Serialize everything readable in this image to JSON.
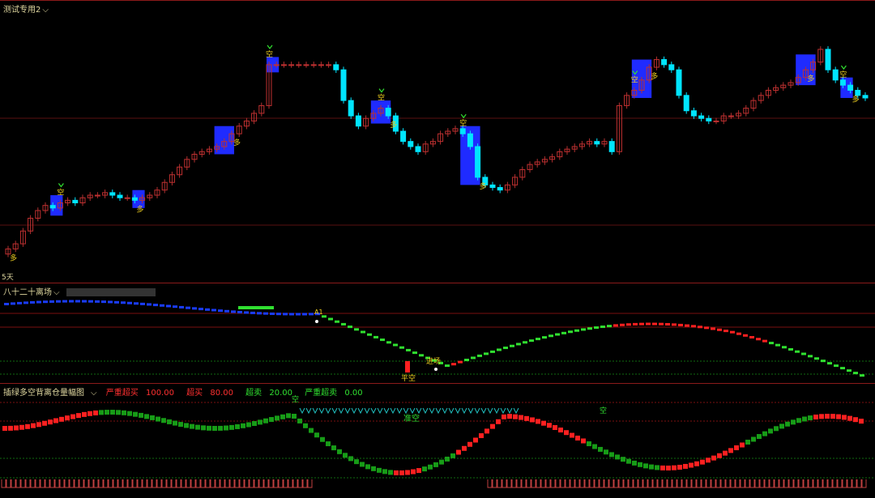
{
  "main_panel": {
    "title": "测试专用2",
    "period_label": "5天",
    "markers": {
      "buy": "多",
      "sell": "空"
    },
    "chart_data": {
      "type": "candlestick",
      "closes": [
        10,
        12,
        17,
        22,
        25,
        27,
        26,
        28,
        29,
        28,
        30,
        31,
        31,
        32,
        31,
        30,
        30,
        29,
        30,
        31,
        33,
        36,
        39,
        42,
        45,
        47,
        48,
        49,
        50,
        52,
        55,
        58,
        60,
        63,
        66,
        82,
        82,
        82,
        82,
        82,
        82,
        82,
        82,
        82,
        80,
        68,
        62,
        58,
        61,
        63,
        65,
        62,
        56,
        52,
        50,
        48,
        51,
        52,
        55,
        56,
        57,
        55,
        50,
        38,
        35,
        34,
        33,
        35,
        38,
        41,
        43,
        44,
        45,
        46,
        48,
        49,
        50,
        51,
        52,
        51,
        52,
        48,
        66,
        70,
        72,
        76,
        81,
        84,
        82,
        80,
        70,
        64,
        62,
        61,
        60,
        60,
        62,
        62,
        63,
        65,
        68,
        70,
        72,
        73,
        74,
        75,
        77,
        80,
        83,
        88,
        80,
        76,
        74,
        72,
        70,
        69
      ]
    }
  },
  "mid_panel": {
    "title": "八十二十离场",
    "labels": {
      "enter": "进场",
      "exit": "平空",
      "marker": "A1"
    }
  },
  "low_panel": {
    "title": "插绿多空背离仓量幅图",
    "legend": [
      {
        "label": "严重超买",
        "value": "100.00",
        "color": "#ff3030"
      },
      {
        "label": "超买",
        "value": "80.00",
        "color": "#ff3030"
      },
      {
        "label": "超卖",
        "value": "20.00",
        "color": "#30e030"
      },
      {
        "label": "严重超卖",
        "value": "0.00",
        "color": "#30e030"
      }
    ],
    "labels": {
      "sell": "空",
      "watch": "准空"
    }
  },
  "colors": {
    "up": "#8b1a1a",
    "down": "#00e5ff",
    "box": "#1f2bff",
    "red": "#ff2020",
    "green": "#20c020",
    "blue": "#1a3cff"
  }
}
